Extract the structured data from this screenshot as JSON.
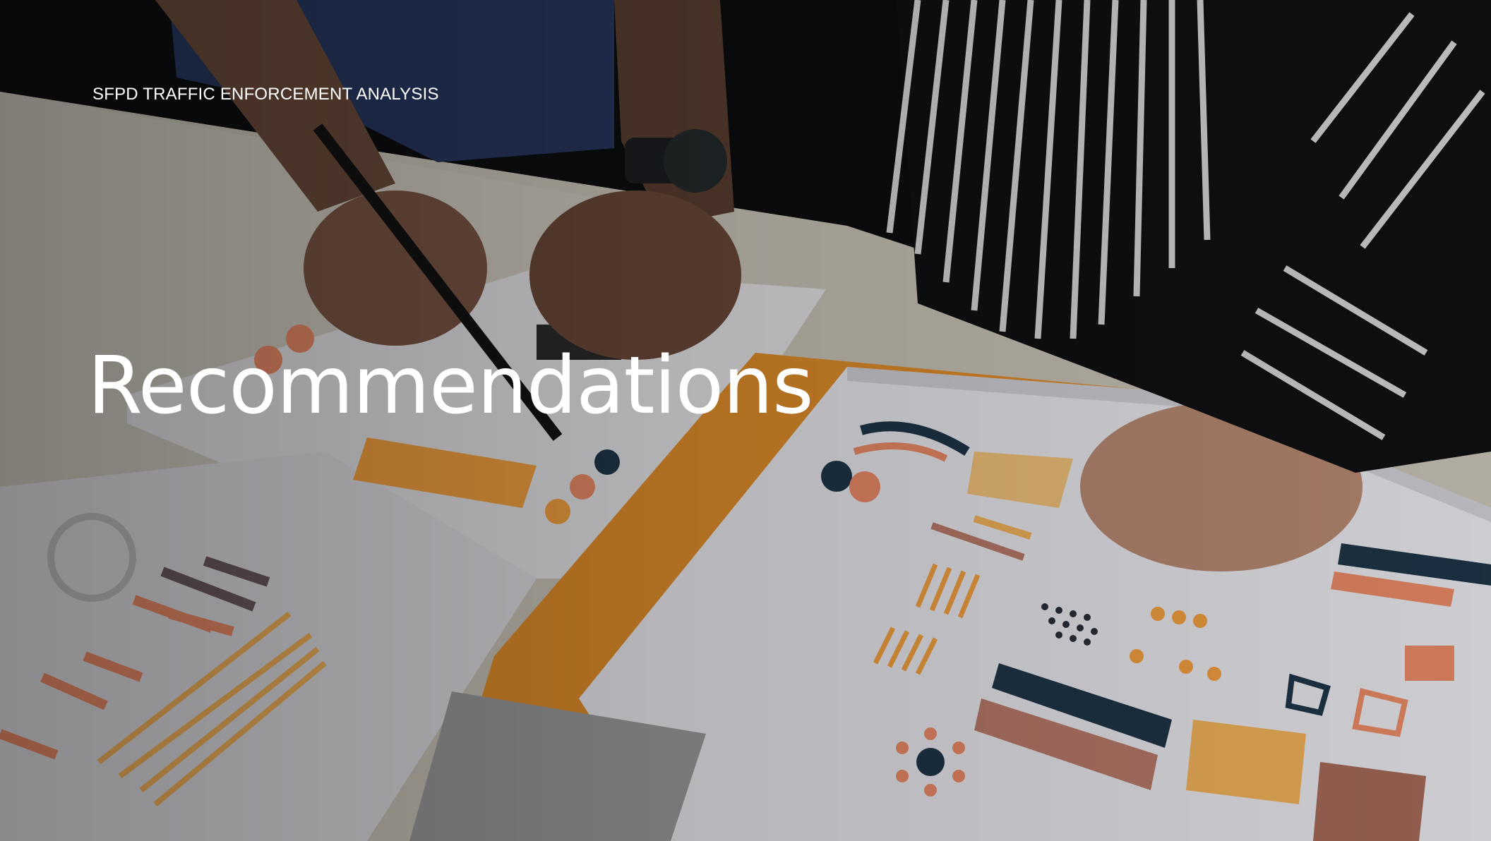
{
  "slide": {
    "eyebrow": "SFPD TRAFFIC ENFORCEMENT ANALYSIS",
    "title": "Recommendations"
  },
  "background": {
    "image_subject": "hands working over printed infographic charts on a desk",
    "colors": {
      "table": "#e6e2d8",
      "paper": "#f2f2f4",
      "folder_orange": "#f29b30",
      "accent_salmon": "#ea8a66",
      "navy": "#1f3548",
      "shirt_dark": "#0c0c0e"
    }
  }
}
